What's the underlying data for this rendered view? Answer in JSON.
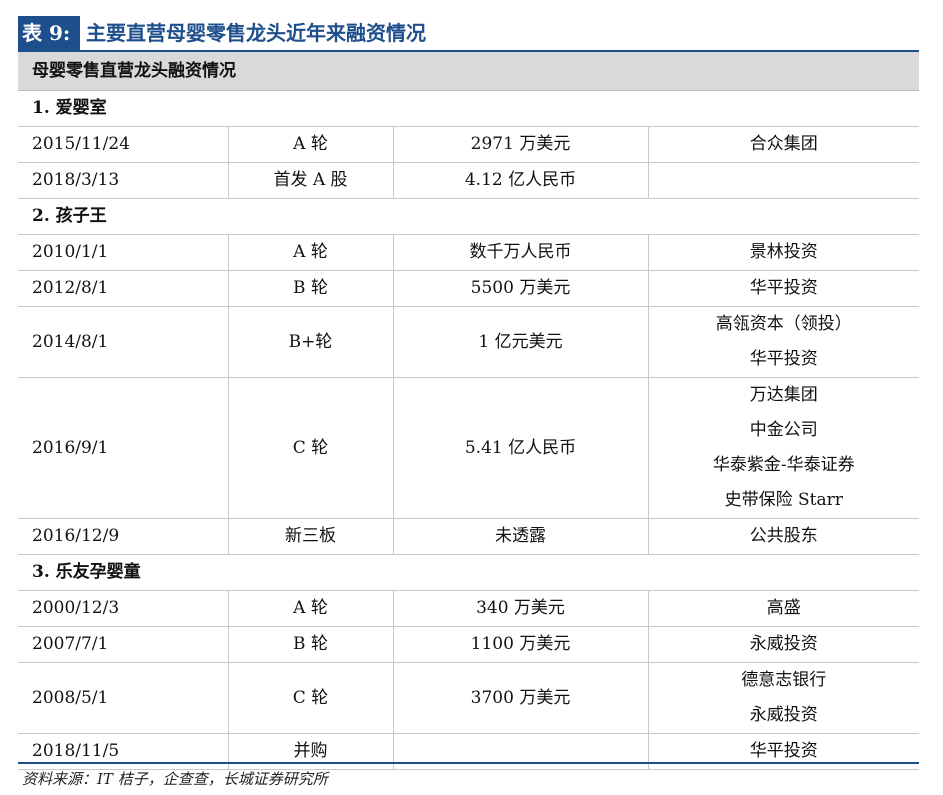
{
  "title": {
    "tag": "表 9:",
    "text": "主要直营母婴零售龙头近年来融资情况"
  },
  "table": {
    "header": "母婴零售直营龙头融资情况",
    "sections": [
      {
        "name": "1. 爱婴室",
        "rows": [
          {
            "date": "2015/11/24",
            "round": "A 轮",
            "amount": "2971 万美元",
            "investors": [
              "合众集团"
            ]
          },
          {
            "date": "2018/3/13",
            "round": "首发 A 股",
            "amount": "4.12 亿人民币",
            "investors": []
          }
        ]
      },
      {
        "name": "2. 孩子王",
        "rows": [
          {
            "date": "2010/1/1",
            "round": "A 轮",
            "amount": "数千万人民币",
            "investors": [
              "景林投资"
            ]
          },
          {
            "date": "2012/8/1",
            "round": "B 轮",
            "amount": "5500 万美元",
            "investors": [
              "华平投资"
            ]
          },
          {
            "date": "2014/8/1",
            "round": "B+轮",
            "amount": "1 亿元美元",
            "investors": [
              "高瓴资本（领投）",
              "华平投资"
            ]
          },
          {
            "date": "2016/9/1",
            "round": "C 轮",
            "amount": "5.41 亿人民币",
            "investors": [
              "万达集团",
              "中金公司",
              "华泰紫金-华泰证券",
              "史带保险 Starr"
            ]
          },
          {
            "date": "2016/12/9",
            "round": "新三板",
            "amount": "未透露",
            "investors": [
              "公共股东"
            ]
          }
        ]
      },
      {
        "name": "3. 乐友孕婴童",
        "rows": [
          {
            "date": "2000/12/3",
            "round": "A 轮",
            "amount": "340 万美元",
            "investors": [
              "高盛"
            ]
          },
          {
            "date": "2007/7/1",
            "round": "B 轮",
            "amount": "1100 万美元",
            "investors": [
              "永威投资"
            ]
          },
          {
            "date": "2008/5/1",
            "round": "C 轮",
            "amount": "3700 万美元",
            "investors": [
              "德意志银行",
              "永威投资"
            ]
          },
          {
            "date": "2018/11/5",
            "round": "并购",
            "amount": "",
            "investors": [
              "华平投资"
            ]
          }
        ]
      }
    ]
  },
  "source": "资料来源：IT 桔子，企查查，长城证券研究所"
}
